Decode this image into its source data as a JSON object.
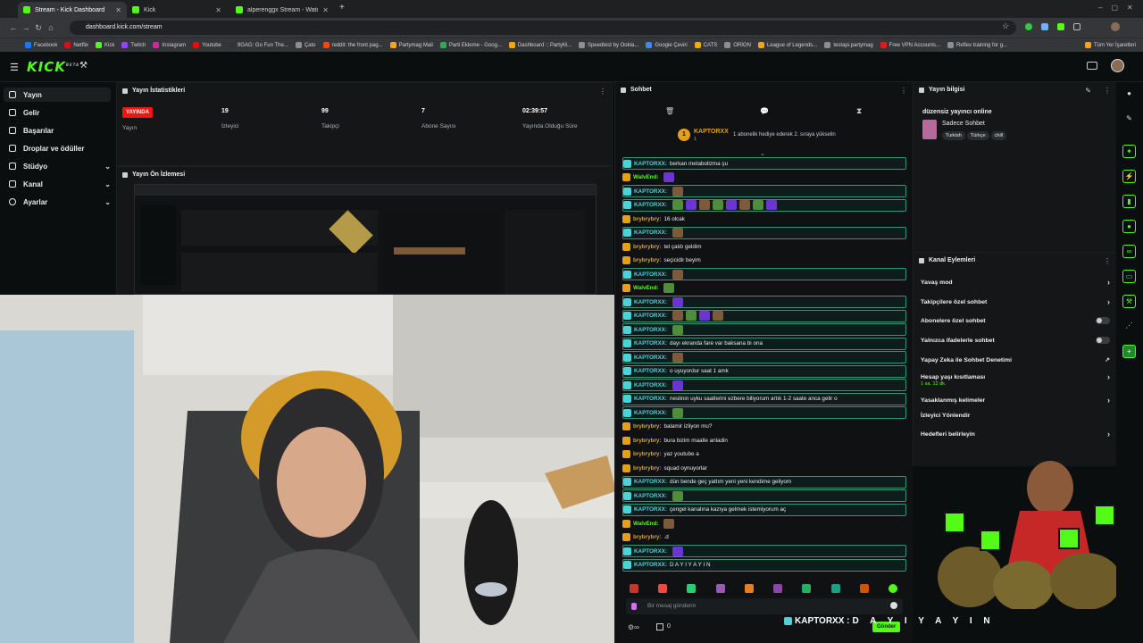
{
  "browser": {
    "tabs": [
      {
        "title": "Stream - Kick Dashboard",
        "active": true
      },
      {
        "title": "Kick",
        "active": false
      },
      {
        "title": "alperenggx Stream - Watch Liv",
        "active": false
      }
    ],
    "url": "dashboard.kick.com/stream",
    "bookmarks": [
      "Facebook",
      "Netflix",
      "Kick",
      "Twitch",
      "Instagram",
      "Youtube",
      "9GAG: Go Fun The...",
      "Çato",
      "reddit: the front pag...",
      "Partymag Mail",
      "Parti Ekleme - Goog...",
      "Dashboard :: PartyM...",
      "Speedtest by Ookla...",
      "Google Çeviri",
      "CATS",
      "ORİON",
      "League of Legends...",
      "testapi.partymag",
      "Free VPN Accounts...",
      "Reflex training for g..."
    ],
    "bookmarks_all": "Tüm Yer İşaretleri"
  },
  "app": {
    "logo": "KICK",
    "logo_beta": "BETA"
  },
  "sidebar": {
    "items": [
      {
        "label": "Yayın",
        "active": true,
        "chevron": false
      },
      {
        "label": "Gelir",
        "active": false,
        "chevron": false
      },
      {
        "label": "Başarılar",
        "active": false,
        "chevron": false
      },
      {
        "label": "Droplar ve ödüller",
        "active": false,
        "chevron": false
      },
      {
        "label": "Stüdyo",
        "active": false,
        "chevron": true
      },
      {
        "label": "Kanal",
        "active": false,
        "chevron": true
      },
      {
        "label": "Ayarlar",
        "active": false,
        "chevron": true
      }
    ]
  },
  "stats": {
    "title": "Yayın İstatistikleri",
    "live_badge": "YAYINDA",
    "live_label": "Yayın",
    "viewers": {
      "value": "19",
      "label": "İzleyici"
    },
    "followers": {
      "value": "99",
      "label": "Takipçi"
    },
    "subs": {
      "value": "7",
      "label": "Abone Sayısı"
    },
    "uptime": {
      "value": "02:39:57",
      "label": "Yayında Olduğu Süre"
    }
  },
  "preview": {
    "title": "Yayın Ön İzlemesi"
  },
  "chat": {
    "title": "Sohbet",
    "pinned_user": "KAPTORXX",
    "pinned_count": "1",
    "pinned_text": "1 abonelik hediye ederek 2. sıraya yükselin",
    "input_placeholder": "Bir mesaj gönderin",
    "footer_count": "0",
    "send_label": "Gönder",
    "messages": [
      {
        "user": "KAPTORXX:",
        "text": "berkan metabolizma şu",
        "color": "#4fd1d9",
        "hl": true,
        "emotes": 0
      },
      {
        "user": "WalvEnd:",
        "text": "",
        "color": "#53fc18",
        "hl": false,
        "emotes": 1
      },
      {
        "user": "KAPTORXX:",
        "text": "",
        "color": "#4fd1d9",
        "hl": true,
        "emotes": 1
      },
      {
        "user": "KAPTORXX:",
        "text": "",
        "color": "#4fd1d9",
        "hl": true,
        "emotes": 8
      },
      {
        "user": "brybrybry:",
        "text": "16 olcak",
        "color": "#e3a01d",
        "hl": false,
        "emotes": 0
      },
      {
        "user": "KAPTORXX:",
        "text": "",
        "color": "#4fd1d9",
        "hl": true,
        "emotes": 1
      },
      {
        "user": "brybrybry:",
        "text": "tel çaldı geldim",
        "color": "#e3a01d",
        "hl": false,
        "emotes": 0
      },
      {
        "user": "brybrybry:",
        "text": "seçicidir beyim",
        "color": "#e3a01d",
        "hl": false,
        "emotes": 0
      },
      {
        "user": "KAPTORXX:",
        "text": "",
        "color": "#4fd1d9",
        "hl": true,
        "emotes": 1
      },
      {
        "user": "WalvEnd:",
        "text": "",
        "color": "#53fc18",
        "hl": false,
        "emotes": 1
      },
      {
        "user": "KAPTORXX:",
        "text": "",
        "color": "#4fd1d9",
        "hl": true,
        "emotes": 1
      },
      {
        "user": "KAPTORXX:",
        "text": "",
        "color": "#4fd1d9",
        "hl": true,
        "emotes": 4
      },
      {
        "user": "KAPTORXX:",
        "text": "",
        "color": "#4fd1d9",
        "hl": true,
        "emotes": 1
      },
      {
        "user": "KAPTORXX:",
        "text": "dayı ekranda fare var baksana bi ona",
        "color": "#4fd1d9",
        "hl": true,
        "emotes": 0
      },
      {
        "user": "KAPTORXX:",
        "text": "",
        "color": "#4fd1d9",
        "hl": true,
        "emotes": 1
      },
      {
        "user": "KAPTORXX:",
        "text": "o uyuyordur saat 1 amk",
        "color": "#4fd1d9",
        "hl": true,
        "emotes": 0
      },
      {
        "user": "KAPTORXX:",
        "text": "",
        "color": "#4fd1d9",
        "hl": true,
        "emotes": 1
      },
      {
        "user": "KAPTORXX:",
        "text": "neslinin uyku saatlerini ezbere biliyorum artık 1-2 saate anca gelir o",
        "color": "#4fd1d9",
        "hl": true,
        "emotes": 0
      },
      {
        "user": "KAPTORXX:",
        "text": "",
        "color": "#4fd1d9",
        "hl": true,
        "emotes": 1
      },
      {
        "user": "brybrybry:",
        "text": "balamir izliyon mu?",
        "color": "#e3a01d",
        "hl": false,
        "emotes": 0
      },
      {
        "user": "brybrybry:",
        "text": "bura bizim maalle anladin",
        "color": "#e3a01d",
        "hl": false,
        "emotes": 0
      },
      {
        "user": "brybrybry:",
        "text": "yaz youtube a",
        "color": "#e3a01d",
        "hl": false,
        "emotes": 0
      },
      {
        "user": "brybrybry:",
        "text": "squad oynuyorlar",
        "color": "#e3a01d",
        "hl": false,
        "emotes": 0
      },
      {
        "user": "KAPTORXX:",
        "text": "dün bende geç yattım yeni yeni kendime geliyom",
        "color": "#4fd1d9",
        "hl": true,
        "emotes": 0
      },
      {
        "user": "KAPTORXX:",
        "text": "",
        "color": "#4fd1d9",
        "hl": true,
        "emotes": 1
      },
      {
        "user": "KAPTORXX:",
        "text": "çengel kanalına kazıya gelmek istemiyorum aç",
        "color": "#4fd1d9",
        "hl": true,
        "emotes": 0
      },
      {
        "user": "WalvEnd:",
        "text": "",
        "color": "#53fc18",
        "hl": false,
        "emotes": 1
      },
      {
        "user": "brybrybry:",
        "text": ".d",
        "color": "#e3a01d",
        "hl": false,
        "emotes": 0
      },
      {
        "user": "KAPTORXX:",
        "text": "",
        "color": "#4fd1d9",
        "hl": true,
        "emotes": 1
      },
      {
        "user": "KAPTORXX:",
        "text": "D A Y I Y A Y I N",
        "color": "#4fd1d9",
        "hl": true,
        "emotes": 0
      }
    ]
  },
  "info": {
    "title": "Yayın bilgisi",
    "stream_title": "düzensiz yayıncı online",
    "category": "Sadece Sohbet",
    "tags": [
      "Turkish",
      "Türkçe",
      "chill"
    ]
  },
  "actions": {
    "title": "Kanal Eylemleri",
    "items": [
      {
        "label": "Yavaş mod",
        "control": "chevron"
      },
      {
        "label": "Takipçilere özel sohbet",
        "control": "chevron"
      },
      {
        "label": "Abonelere özel sohbet",
        "control": "toggle"
      },
      {
        "label": "Yalnızca ifadelerle sohbet",
        "control": "toggle"
      },
      {
        "label": "Yapay Zeka ile Sohbet Denetimi",
        "control": "link"
      },
      {
        "label": "Hesap yaşı kısıtlaması",
        "control": "chevron",
        "sub": "1 sa. 12 dk."
      },
      {
        "label": "Yasaklanmış kelimeler",
        "control": "chevron"
      },
      {
        "label": "İzleyici Yönlendir",
        "control": "none"
      },
      {
        "label": "Hedefleri belirleyin",
        "control": "chevron"
      }
    ]
  },
  "overlay": {
    "alert_user": "KAPTORXX :",
    "alert_text": "D A Y I Y A Y I N"
  },
  "colors": {
    "brand": "#53fc18",
    "live": "#e91916",
    "bg": "#0b0e0f",
    "panel": "#141618"
  }
}
